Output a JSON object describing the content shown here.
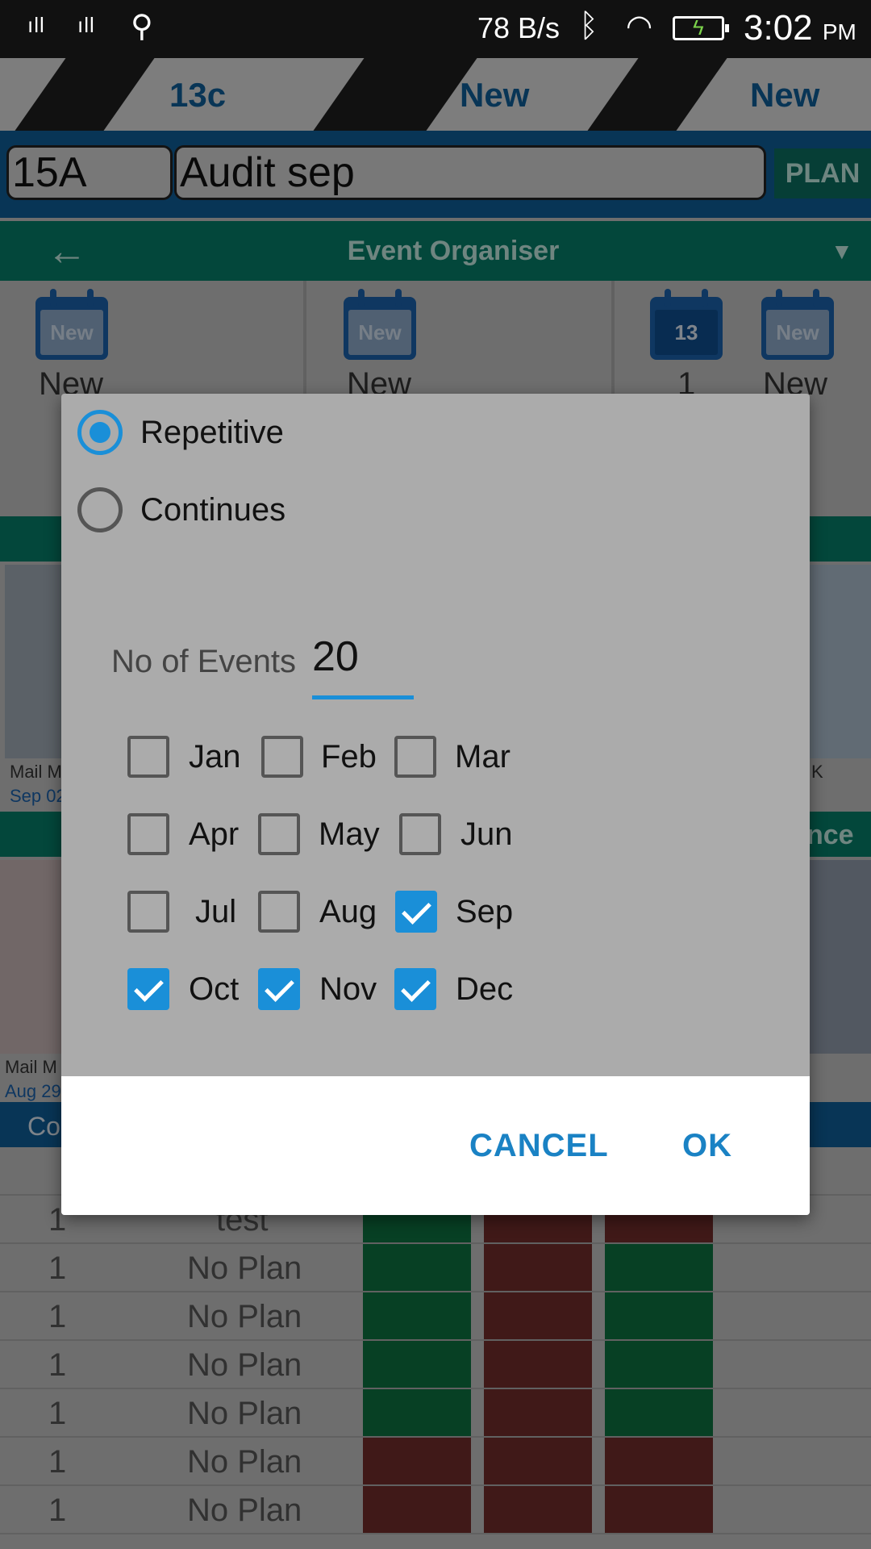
{
  "status_bar": {
    "signal1": "ıll",
    "signal2": "ıll",
    "net_speed": "78 B/s",
    "time": "3:02",
    "ampm": "PM"
  },
  "tabs": [
    "13c",
    "New",
    "New"
  ],
  "header": {
    "field1": "15A",
    "field2": "Audit sep",
    "plan_button": "PLAN"
  },
  "organiser": {
    "title": "Event Organiser"
  },
  "calendars": [
    {
      "icon_text": "New",
      "label": "New"
    },
    {
      "icon_text": "New",
      "label": "New"
    },
    {
      "icon_text": "13",
      "label": "1"
    },
    {
      "icon_text": "New",
      "label": "New"
    }
  ],
  "thumbnails": {
    "caption1": "Mail M",
    "date1": "Sep 02",
    "caption2": "Mail M",
    "date2": "Aug 29",
    "right_caption": "K",
    "right_band": "nce"
  },
  "table": {
    "header_label": "Co",
    "rows": [
      {
        "num": "1",
        "text": "test"
      },
      {
        "num": "1",
        "text": "No Plan"
      },
      {
        "num": "1",
        "text": "No Plan"
      },
      {
        "num": "1",
        "text": "No Plan"
      },
      {
        "num": "1",
        "text": "No Plan"
      },
      {
        "num": "1",
        "text": "No Plan"
      },
      {
        "num": "1",
        "text": "No Plan"
      }
    ]
  },
  "dialog": {
    "options": [
      {
        "label": "Repetitive",
        "selected": true
      },
      {
        "label": "Continues",
        "selected": false
      }
    ],
    "no_of_events_label": "No of Events",
    "no_of_events_value": "20",
    "months": [
      {
        "label": "Jan",
        "checked": false
      },
      {
        "label": "Feb",
        "checked": false
      },
      {
        "label": "Mar",
        "checked": false
      },
      {
        "label": "Apr",
        "checked": false
      },
      {
        "label": "May",
        "checked": false
      },
      {
        "label": "Jun",
        "checked": false
      },
      {
        "label": "Jul",
        "checked": false
      },
      {
        "label": "Aug",
        "checked": false
      },
      {
        "label": "Sep",
        "checked": true
      },
      {
        "label": "Oct",
        "checked": true
      },
      {
        "label": "Nov",
        "checked": true
      },
      {
        "label": "Dec",
        "checked": true
      }
    ],
    "cancel_label": "CANCEL",
    "ok_label": "OK"
  },
  "colors": {
    "accent": "#1a8fd8",
    "teal": "#067a66",
    "navy": "#0e5c95"
  }
}
